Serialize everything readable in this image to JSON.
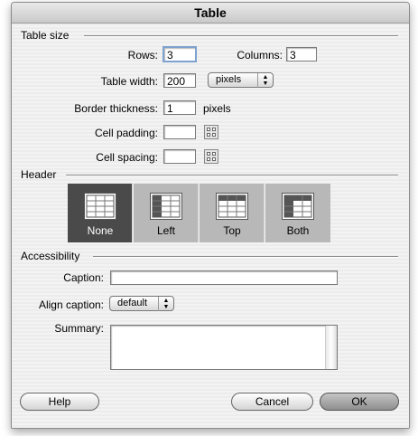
{
  "window": {
    "title": "Table"
  },
  "table_size": {
    "section_label": "Table size",
    "rows_label": "Rows:",
    "rows_value": "3",
    "columns_label": "Columns:",
    "columns_value": "3",
    "width_label": "Table width:",
    "width_value": "200",
    "width_unit": "pixels",
    "border_label": "Border thickness:",
    "border_value": "1",
    "border_unit": "pixels",
    "padding_label": "Cell padding:",
    "padding_value": "",
    "spacing_label": "Cell spacing:",
    "spacing_value": ""
  },
  "header": {
    "section_label": "Header",
    "options": [
      {
        "label": "None",
        "selected": true,
        "icon": "table-header-none-icon"
      },
      {
        "label": "Left",
        "selected": false,
        "icon": "table-header-left-icon"
      },
      {
        "label": "Top",
        "selected": false,
        "icon": "table-header-top-icon"
      },
      {
        "label": "Both",
        "selected": false,
        "icon": "table-header-both-icon"
      }
    ]
  },
  "accessibility": {
    "section_label": "Accessibility",
    "caption_label": "Caption:",
    "caption_value": "",
    "align_label": "Align caption:",
    "align_value": "default",
    "summary_label": "Summary:",
    "summary_value": ""
  },
  "buttons": {
    "help": "Help",
    "cancel": "Cancel",
    "ok": "OK"
  },
  "colors": {
    "selected_segment": "#4a4a4a",
    "unselected_segment": "#b8b8b8",
    "focus_ring": "#7da2ce"
  }
}
